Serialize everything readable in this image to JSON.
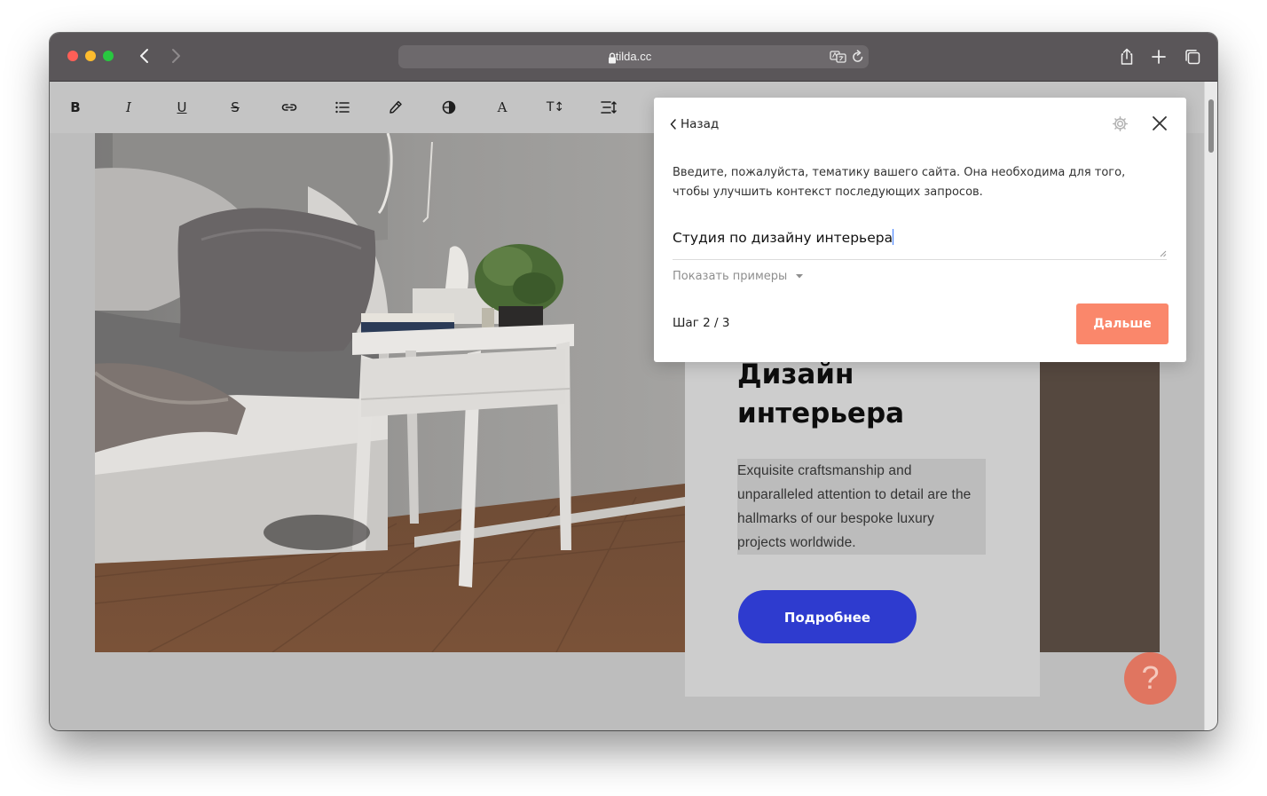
{
  "browser": {
    "url": "tilda.cc"
  },
  "toolbar": {
    "buttons": [
      {
        "name": "bold",
        "label": "B"
      },
      {
        "name": "italic",
        "label": "I"
      },
      {
        "name": "underline",
        "label": "U"
      },
      {
        "name": "strikethrough",
        "label": "S"
      },
      {
        "name": "link",
        "label": ""
      },
      {
        "name": "list",
        "label": ""
      },
      {
        "name": "color-picker",
        "label": ""
      },
      {
        "name": "contrast",
        "label": ""
      },
      {
        "name": "font",
        "label": "A"
      },
      {
        "name": "font-size",
        "label": "T↕"
      },
      {
        "name": "line-height",
        "label": ""
      }
    ]
  },
  "card": {
    "title": "Дизайн\nинтерьера",
    "text": "Exquisite craftsmanship and unparalleled attention to detail are the hallmarks of our bespoke luxury projects worldwide.",
    "button": "Подробнее"
  },
  "modal": {
    "back": "Назад",
    "description": "Введите, пожалуйста, тематику вашего сайта. Она необходима для того, чтобы улучшить контекст последующих запросов.",
    "topic_value": "Студия по дизайну интерьера",
    "show_examples": "Показать примеры",
    "step": "Шаг 2 / 3",
    "next": "Дальше"
  },
  "help": {
    "label": "?"
  },
  "colors": {
    "accent_button": "#2e3bcf",
    "next_button": "#fa876b",
    "help_button": "#e07560"
  }
}
